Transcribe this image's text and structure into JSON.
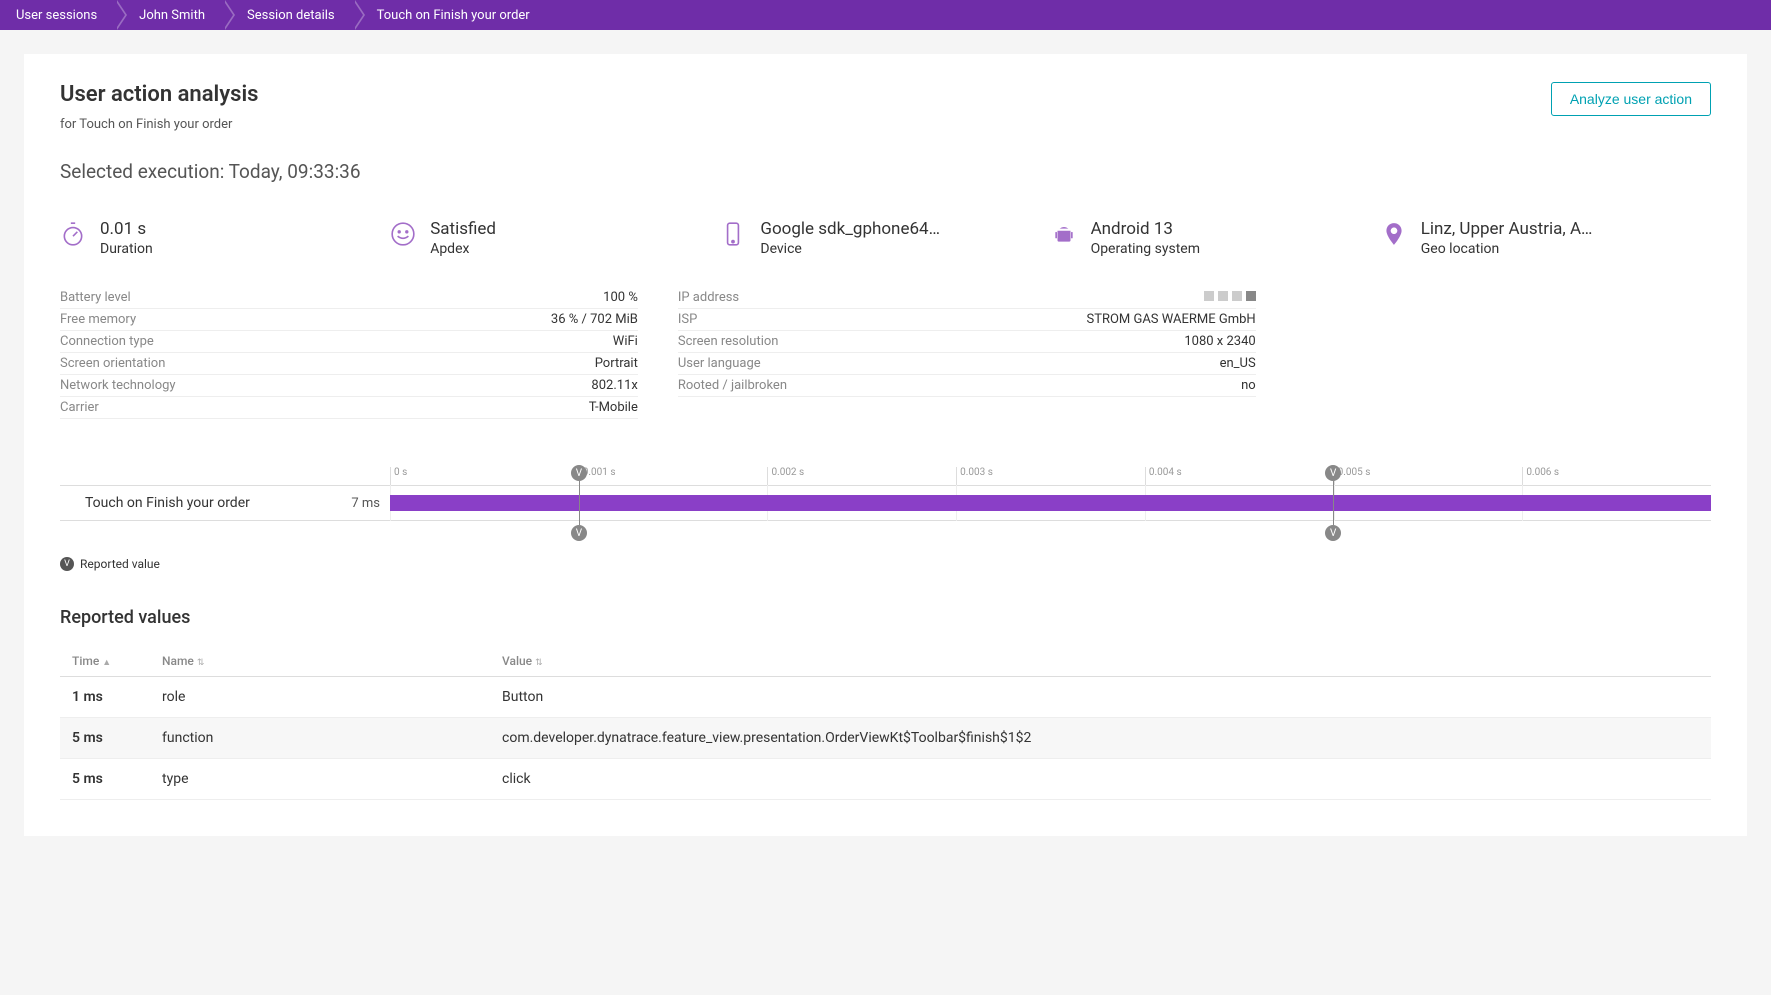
{
  "breadcrumb": [
    "User sessions",
    "John Smith",
    "Session details",
    "Touch on Finish your order"
  ],
  "header": {
    "title": "User action analysis",
    "subtitle": "for Touch on Finish your order",
    "analyze_btn": "Analyze user action"
  },
  "selected_execution": "Selected execution: Today, 09:33:36",
  "metrics": {
    "duration": {
      "value": "0.01 s",
      "label": "Duration"
    },
    "apdex": {
      "value": "Satisfied",
      "label": "Apdex"
    },
    "device": {
      "value": "Google sdk_gphone64…",
      "label": "Device"
    },
    "os": {
      "value": "Android 13",
      "label": "Operating system"
    },
    "geo": {
      "value": "Linz, Upper Austria, A…",
      "label": "Geo location"
    }
  },
  "details_left": [
    {
      "label": "Battery level",
      "value": "100 %"
    },
    {
      "label": "Free memory",
      "value": "36 % / 702 MiB"
    },
    {
      "label": "Connection type",
      "value": "WiFi"
    },
    {
      "label": "Screen orientation",
      "value": "Portrait"
    },
    {
      "label": "Network technology",
      "value": "802.11x"
    },
    {
      "label": "Carrier",
      "value": "T-Mobile"
    }
  ],
  "details_right": [
    {
      "label": "IP address",
      "value": ""
    },
    {
      "label": "ISP",
      "value": "STROM GAS WAERME GmbH"
    },
    {
      "label": "Screen resolution",
      "value": "1080 x 2340"
    },
    {
      "label": "User language",
      "value": "en_US"
    },
    {
      "label": "Rooted / jailbroken",
      "value": "no"
    }
  ],
  "timeline": {
    "ticks": [
      "0 s",
      "0.001 s",
      "0.002 s",
      "0.003 s",
      "0.004 s",
      "0.005 s",
      "0.006 s"
    ],
    "row_label": "Touch on Finish your order",
    "row_duration": "7 ms",
    "markers": [
      {
        "position_pct": 14.3
      },
      {
        "position_pct": 71.4
      }
    ]
  },
  "reported_legend": "Reported value",
  "reported_values": {
    "heading": "Reported values",
    "columns": {
      "time": "Time",
      "name": "Name",
      "value": "Value"
    },
    "rows": [
      {
        "time": "1 ms",
        "name": "role",
        "value": "Button"
      },
      {
        "time": "5 ms",
        "name": "function",
        "value": "com.developer.dynatrace.feature_view.presentation.OrderViewKt$Toolbar$finish$1$2"
      },
      {
        "time": "5 ms",
        "name": "type",
        "value": "click"
      }
    ]
  }
}
